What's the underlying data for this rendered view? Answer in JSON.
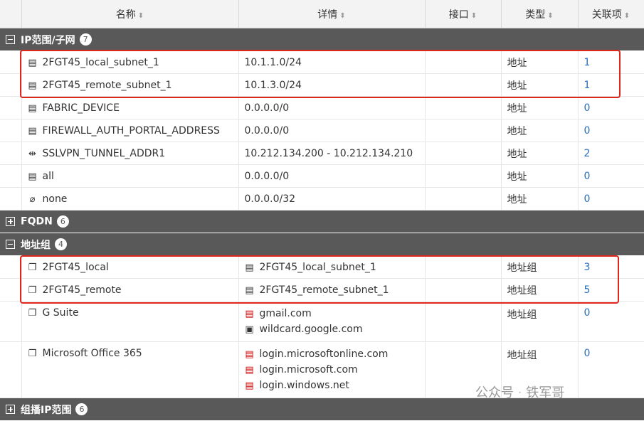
{
  "headers": {
    "name": "名称",
    "details": "详情",
    "interface": "接口",
    "type": "类型",
    "refs": "关联项"
  },
  "groups": [
    {
      "label": "IP范围/子网",
      "count": "7",
      "expanded": true
    },
    {
      "label": "FQDN",
      "count": "6",
      "expanded": false
    },
    {
      "label": "地址组",
      "count": "4",
      "expanded": true
    },
    {
      "label": "组播IP范围",
      "count": "6",
      "expanded": false
    }
  ],
  "ip_rows": [
    {
      "name": "2FGT45_local_subnet_1",
      "details": "10.1.1.0/24",
      "type": "地址",
      "refs": "1",
      "icon": "address-icon"
    },
    {
      "name": "2FGT45_remote_subnet_1",
      "details": "10.1.3.0/24",
      "type": "地址",
      "refs": "1",
      "icon": "address-icon"
    },
    {
      "name": "FABRIC_DEVICE",
      "details": "0.0.0.0/0",
      "type": "地址",
      "refs": "0",
      "icon": "address-icon"
    },
    {
      "name": "FIREWALL_AUTH_PORTAL_ADDRESS",
      "details": "0.0.0.0/0",
      "type": "地址",
      "refs": "0",
      "icon": "address-icon"
    },
    {
      "name": "SSLVPN_TUNNEL_ADDR1",
      "details": "10.212.134.200 - 10.212.134.210",
      "type": "地址",
      "refs": "2",
      "icon": "iprange-icon"
    },
    {
      "name": "all",
      "details": "0.0.0.0/0",
      "type": "地址",
      "refs": "0",
      "icon": "address-icon"
    },
    {
      "name": "none",
      "details": "0.0.0.0/32",
      "type": "地址",
      "refs": "0",
      "icon": "none-icon"
    }
  ],
  "grp_rows": [
    {
      "name": "2FGT45_local",
      "members": [
        "2FGT45_local_subnet_1"
      ],
      "type": "地址组",
      "refs": "3"
    },
    {
      "name": "2FGT45_remote",
      "members": [
        "2FGT45_remote_subnet_1"
      ],
      "type": "地址组",
      "refs": "5"
    },
    {
      "name": "G Suite",
      "members": [
        "gmail.com",
        "wildcard.google.com"
      ],
      "type": "地址组",
      "refs": "0"
    },
    {
      "name": "Microsoft Office 365",
      "members": [
        "login.microsoftonline.com",
        "login.microsoft.com",
        "login.windows.net"
      ],
      "type": "地址组",
      "refs": "0"
    }
  ],
  "watermark": {
    "left": "公众号",
    "sep": "·",
    "right": "铁军哥"
  }
}
